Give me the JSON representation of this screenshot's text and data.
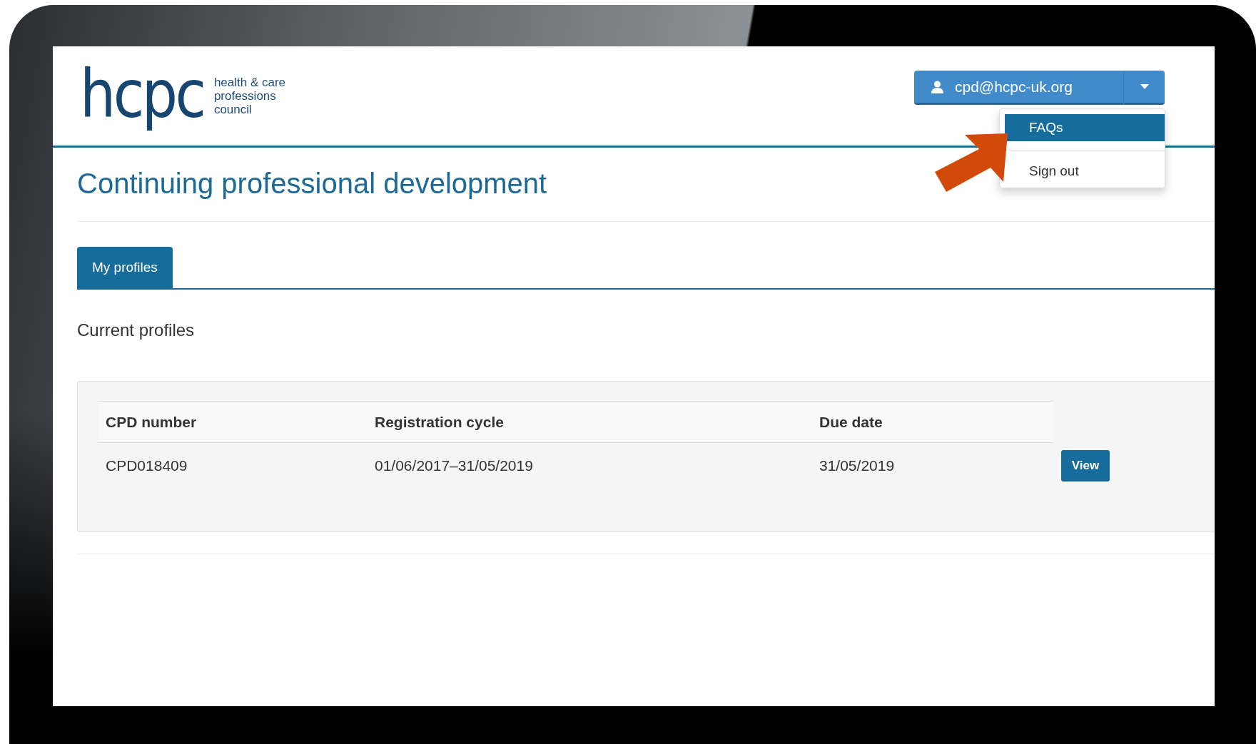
{
  "logo": {
    "wordmark": "hcpc",
    "tagline": [
      "health & care",
      "professions",
      "council"
    ]
  },
  "user_menu": {
    "label": "cpd@hcpc-uk.org",
    "expanded": true,
    "items": [
      {
        "label": "FAQs",
        "selected": true
      },
      {
        "label": "Sign out",
        "selected": false
      }
    ]
  },
  "page_title": "Continuing professional development",
  "tabs": [
    {
      "label": "My profiles",
      "selected": true
    }
  ],
  "section_title": "Current profiles",
  "table": {
    "columns": [
      "CPD number",
      "Registration cycle",
      "Due date"
    ],
    "rows": [
      {
        "cells": [
          "CPD018409",
          "01/06/2017–31/05/2019",
          "31/05/2019"
        ],
        "action": "View"
      }
    ]
  }
}
